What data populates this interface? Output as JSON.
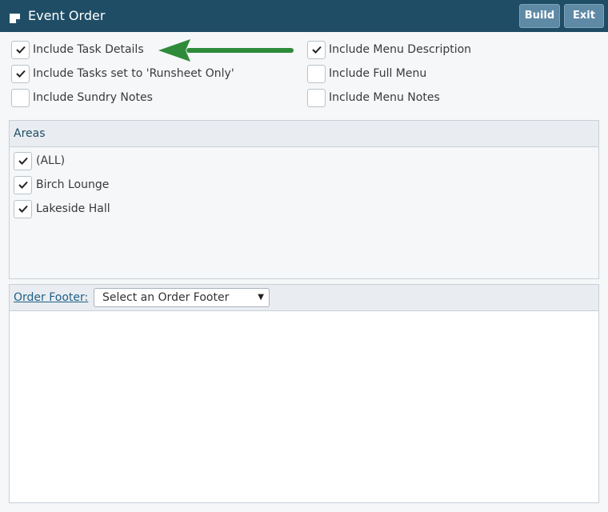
{
  "window": {
    "title": "Event Order",
    "title_icon": "note-icon",
    "build_label": "Build",
    "exit_label": "Exit"
  },
  "options": [
    {
      "label": "Include Task Details",
      "checked": true
    },
    {
      "label": "Include Menu Description",
      "checked": true
    },
    {
      "label": "Include Tasks set to 'Runsheet Only'",
      "checked": true
    },
    {
      "label": "Include Full Menu",
      "checked": false
    },
    {
      "label": "Include Sundry Notes",
      "checked": false
    },
    {
      "label": "Include Menu Notes",
      "checked": false
    }
  ],
  "annotation": {
    "arrow_color": "#2e8b3a",
    "points_to": "Include Task Details"
  },
  "areas": {
    "title": "Areas",
    "items": [
      {
        "label": "(ALL)",
        "checked": true
      },
      {
        "label": "Birch Lounge",
        "checked": true
      },
      {
        "label": "Lakeside Hall",
        "checked": true
      }
    ]
  },
  "order_footer": {
    "label": "Order Footer:",
    "select_value": "Select an Order Footer"
  },
  "colors": {
    "header_bg": "#1f4d66",
    "button_bg": "#5f8aa6",
    "link": "#1f5f86"
  }
}
